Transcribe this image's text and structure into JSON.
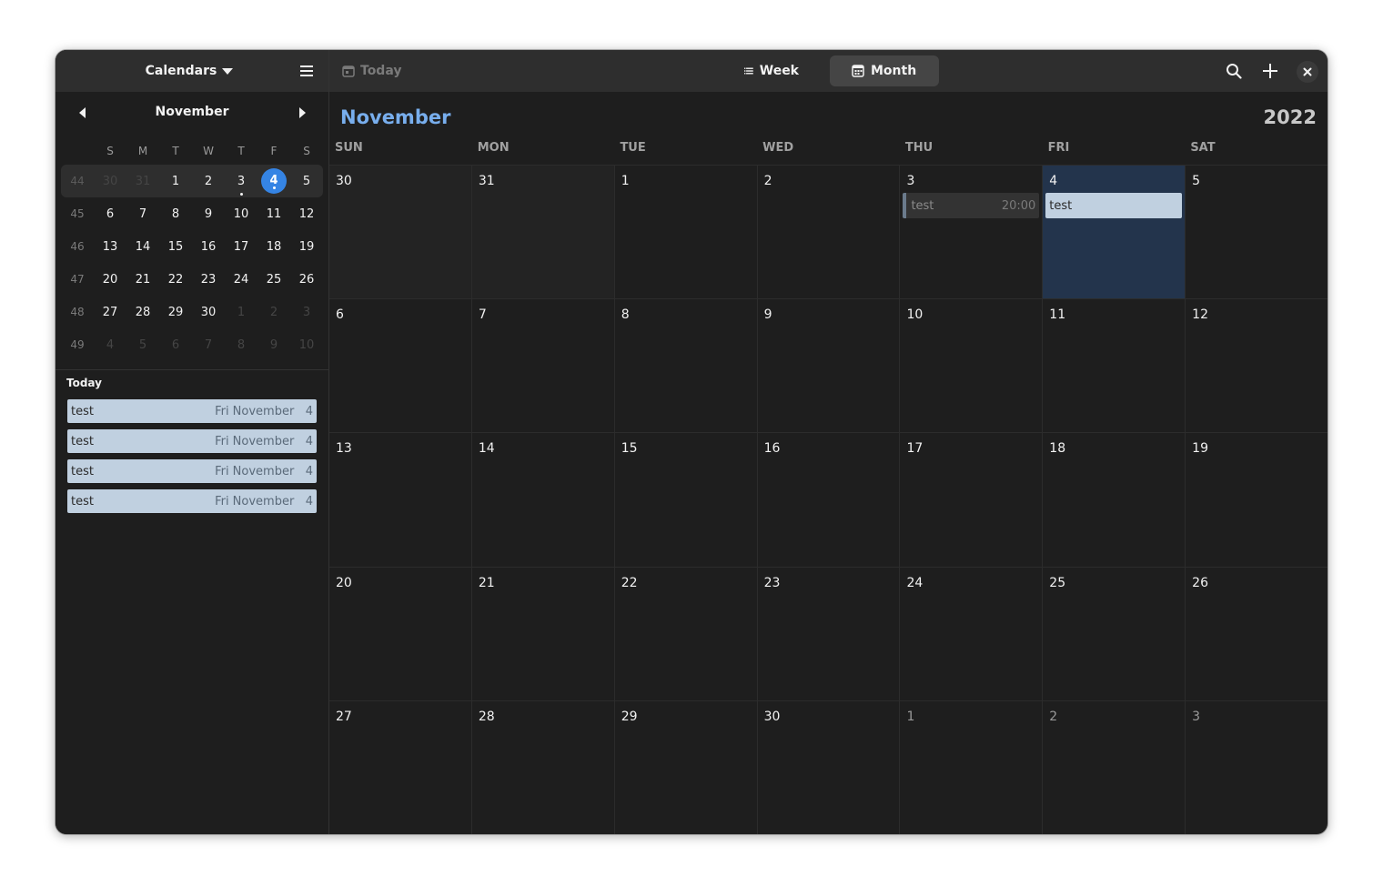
{
  "sidebar": {
    "calendars_label": "Calendars",
    "mini_month": "November",
    "weekdays": [
      "S",
      "M",
      "T",
      "W",
      "T",
      "F",
      "S"
    ],
    "weeks": [
      {
        "num": "44",
        "days": [
          "30",
          "31",
          "1",
          "2",
          "3",
          "4",
          "5"
        ]
      },
      {
        "num": "45",
        "days": [
          "6",
          "7",
          "8",
          "9",
          "10",
          "11",
          "12"
        ]
      },
      {
        "num": "46",
        "days": [
          "13",
          "14",
          "15",
          "16",
          "17",
          "18",
          "19"
        ]
      },
      {
        "num": "47",
        "days": [
          "20",
          "21",
          "22",
          "23",
          "24",
          "25",
          "26"
        ]
      },
      {
        "num": "48",
        "days": [
          "27",
          "28",
          "29",
          "30",
          "1",
          "2",
          "3"
        ]
      },
      {
        "num": "49",
        "days": [
          "4",
          "5",
          "6",
          "7",
          "8",
          "9",
          "10"
        ]
      }
    ],
    "today_label": "Today",
    "today_events": [
      {
        "title": "test",
        "date": "Fri November",
        "day": "4"
      },
      {
        "title": "test",
        "date": "Fri November",
        "day": "4"
      },
      {
        "title": "test",
        "date": "Fri November",
        "day": "4"
      },
      {
        "title": "test",
        "date": "Fri November",
        "day": "4"
      }
    ]
  },
  "header": {
    "today_label": "Today",
    "week_label": "Week",
    "month_label": "Month",
    "active_view": "Month"
  },
  "main": {
    "month": "November",
    "year": "2022",
    "weekdays": [
      "SUN",
      "MON",
      "TUE",
      "WED",
      "THU",
      "FRI",
      "SAT"
    ],
    "weeks": [
      [
        "30",
        "31",
        "1",
        "2",
        "3",
        "4",
        "5"
      ],
      [
        "6",
        "7",
        "8",
        "9",
        "10",
        "11",
        "12"
      ],
      [
        "13",
        "14",
        "15",
        "16",
        "17",
        "18",
        "19"
      ],
      [
        "20",
        "21",
        "22",
        "23",
        "24",
        "25",
        "26"
      ],
      [
        "27",
        "28",
        "29",
        "30",
        "1",
        "2",
        "3"
      ]
    ],
    "events": {
      "thu3": {
        "title": "test",
        "time": "20:00"
      },
      "fri4": {
        "title": "test"
      }
    }
  },
  "colors": {
    "accent": "#3584e4",
    "month_title": "#78aeed",
    "selected_day": "#23344c",
    "event": "#c0d0e0"
  }
}
